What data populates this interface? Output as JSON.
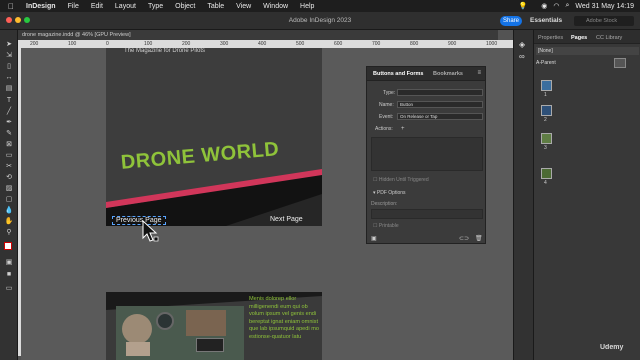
{
  "menubar": {
    "apple": "",
    "app_name": "InDesign",
    "items": [
      "File",
      "Edit",
      "Layout",
      "Type",
      "Object",
      "Table",
      "View",
      "Window",
      "Help"
    ],
    "datetime": "Wed 31 May  14:19"
  },
  "titlebar": {
    "title": "Adobe InDesign 2023",
    "share_label": "Share",
    "workspace": "Essentials",
    "search_placeholder": "Adobe Stock"
  },
  "document": {
    "tab_label": "drone magazine.indd @ 46% [GPU Preview]",
    "ruler_marks": [
      "200",
      "100",
      "0",
      "100",
      "200",
      "300",
      "400",
      "500",
      "600",
      "700",
      "800",
      "900",
      "1000"
    ]
  },
  "page1": {
    "tagline": "The Magazine for Drone Pilots",
    "headline": "DRONE WORLD",
    "prev_button": "Previous Page",
    "next_button": "Next Page"
  },
  "page2": {
    "body_text": "Menis dolorep ellor milligenendi eum qui ob volum ipsum vel genis endi bereptat ignat eniam omnist que lab ipsumquid apedi mo estionse-quatuor latu"
  },
  "buttons_panel": {
    "tabs": [
      "Buttons and Forms",
      "Bookmarks"
    ],
    "type_label": "Type:",
    "type_value": "",
    "name_label": "Name:",
    "name_value": "Button",
    "event_label": "Event:",
    "event_value": "On Release or Tap",
    "actions_label": "Actions:",
    "actions_value": "+",
    "hidden_label": "Hidden Until Triggered",
    "pdf_options": "PDF Options",
    "description_label": "Description:",
    "printable_label": "Printable"
  },
  "pages_panel": {
    "tabs": [
      "Properties",
      "Pages",
      "CC Library"
    ],
    "none_label": "[None]",
    "parent_label": "A-Parent",
    "page_numbers": [
      "1",
      "2",
      "3",
      "4"
    ]
  },
  "watermark": "Udemy",
  "colors": {
    "accent": "#1473e6",
    "headline": "#8fc33a",
    "stripe": "#d1365a"
  }
}
